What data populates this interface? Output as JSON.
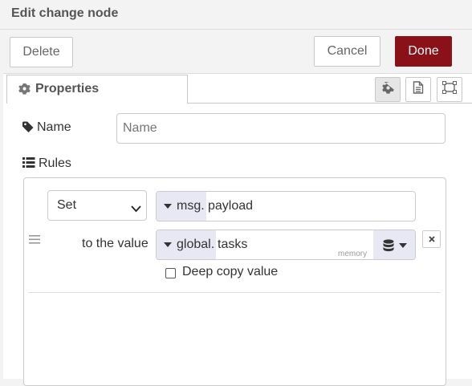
{
  "dialog": {
    "title": "Edit change node"
  },
  "buttons": {
    "delete": "Delete",
    "cancel": "Cancel",
    "done": "Done"
  },
  "tabs": {
    "properties": "Properties"
  },
  "name_field": {
    "label": "Name",
    "placeholder": "Name",
    "value": ""
  },
  "rules": {
    "label": "Rules",
    "rule": {
      "action": "Set",
      "target_type": "msg.",
      "target_value": "payload",
      "value_label": "to the value",
      "value_type": "global.",
      "value_value": "tasks",
      "store_hint": "memory",
      "deep_copy_label": "Deep copy value",
      "deep_copy_checked": false
    }
  },
  "colors": {
    "done_button": "#8b1118",
    "type_prefix_bg": "#e8e8f4"
  }
}
